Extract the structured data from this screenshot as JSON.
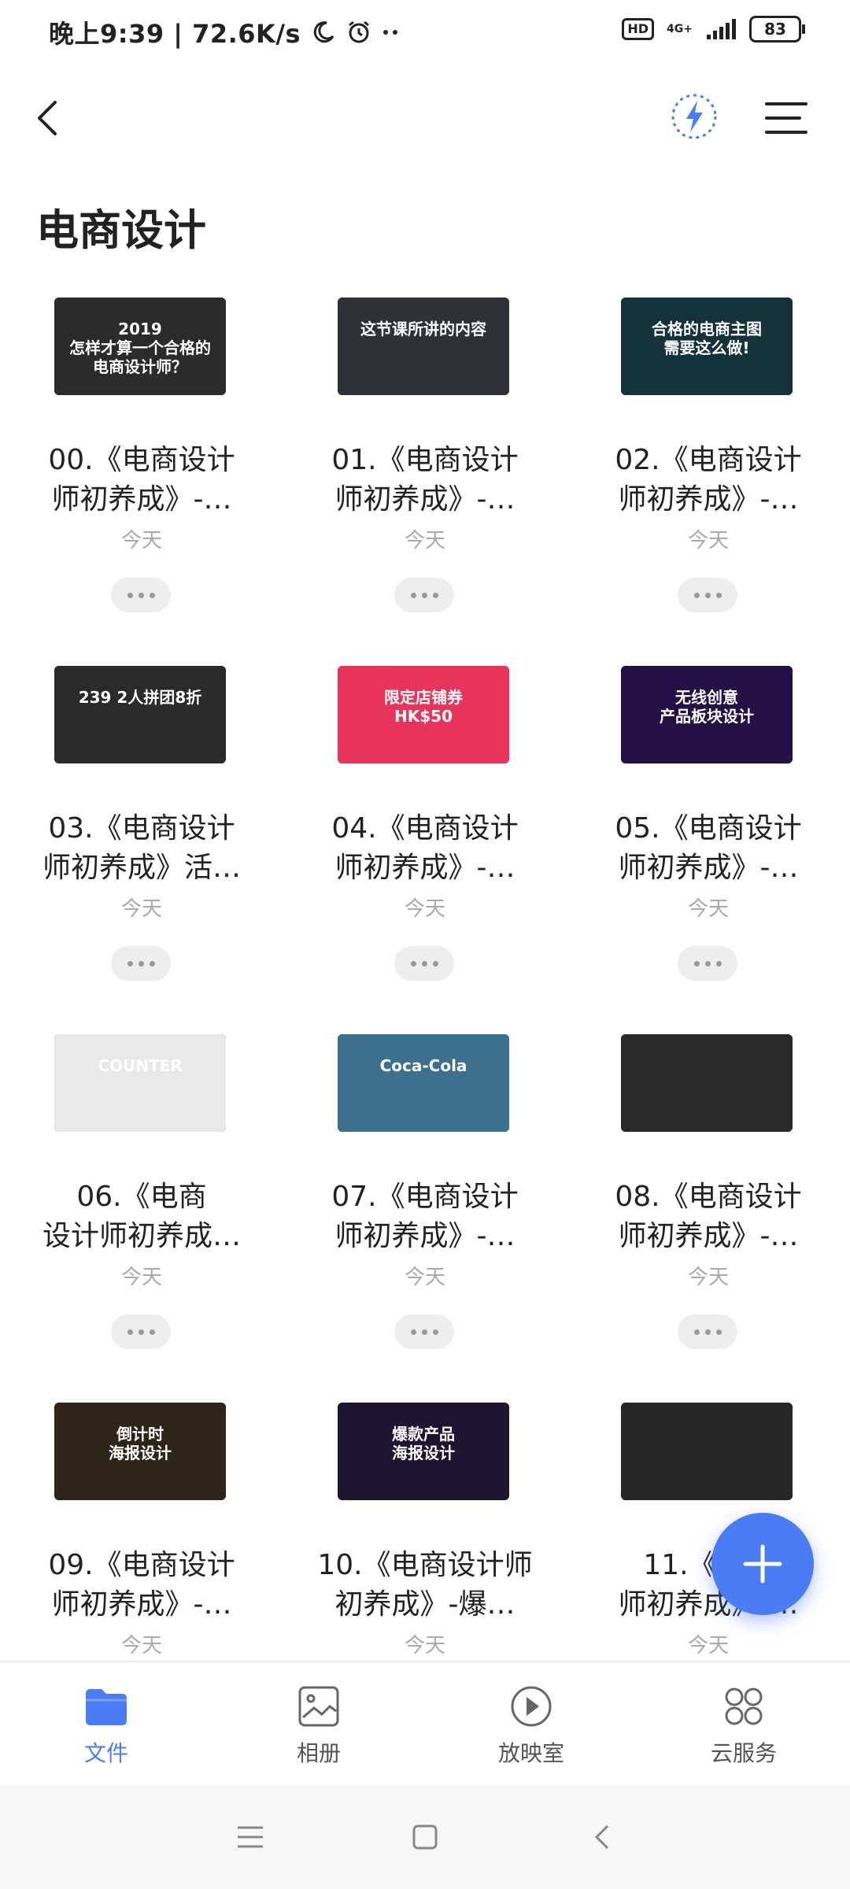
{
  "status_bar": {
    "time_speed": "晚上9:39 | 72.6K/s",
    "hd": "HD",
    "network": "4G+",
    "battery": "83"
  },
  "header": {
    "title": "电商设计"
  },
  "files": [
    {
      "name": "00.《电商设计\n师初养成》-…",
      "date": "今天",
      "thumb_text": "2019\n怎样才算一个合格的\n电商设计师？",
      "thumb_bg": "#2b2b2b"
    },
    {
      "name": "01.《电商设计\n师初养成》-…",
      "date": "今天",
      "thumb_text": "这节课所讲的内容",
      "thumb_bg": "#2e3238"
    },
    {
      "name": "02.《电商设计\n师初养成》-…",
      "date": "今天",
      "thumb_text": "合格的电商主图\n需要这么做!",
      "thumb_bg": "#13323a"
    },
    {
      "name": "03.《电商设计\n师初养成》活…",
      "date": "今天",
      "thumb_text": "239 2人拼团8折",
      "thumb_bg": "#2a2a2a"
    },
    {
      "name": "04.《电商设计\n师初养成》-…",
      "date": "今天",
      "thumb_text": "限定店铺券\nHK$50",
      "thumb_bg": "#e8335a"
    },
    {
      "name": "05.《电商设计\n师初养成》-…",
      "date": "今天",
      "thumb_text": "无线创意\n产品板块设计",
      "thumb_bg": "#241046"
    },
    {
      "name": "06.《电商\n设计师初养成…",
      "date": "今天",
      "thumb_text": "COUNTER",
      "thumb_bg": "#e9e9e9"
    },
    {
      "name": "07.《电商设计\n师初养成》-…",
      "date": "今天",
      "thumb_text": "Coca-Cola",
      "thumb_bg": "#3d6f8f"
    },
    {
      "name": "08.《电商设计\n师初养成》-…",
      "date": "今天",
      "thumb_text": "",
      "thumb_bg": "#2a2a2a"
    },
    {
      "name": "09.《电商设计\n师初养成》-…",
      "date": "今天",
      "thumb_text": "倒计时\n海报设计",
      "thumb_bg": "#2f2418"
    },
    {
      "name": "10.《电商设计师\n初养成》-爆…",
      "date": "今天",
      "thumb_text": "爆款产品\n海报设计",
      "thumb_bg": "#1e1530"
    },
    {
      "name": "11.《电商\n师初养成》-…",
      "date": "今天",
      "thumb_text": "",
      "thumb_bg": "#262626"
    }
  ],
  "bottom_nav": [
    {
      "label": "文件",
      "icon": "folder-icon",
      "active": true
    },
    {
      "label": "相册",
      "icon": "album-icon",
      "active": false
    },
    {
      "label": "放映室",
      "icon": "play-icon",
      "active": false
    },
    {
      "label": "云服务",
      "icon": "apps-icon",
      "active": false
    }
  ],
  "colors": {
    "accent": "#4a7cf6",
    "text": "#222222",
    "muted": "#a9a9a9"
  }
}
